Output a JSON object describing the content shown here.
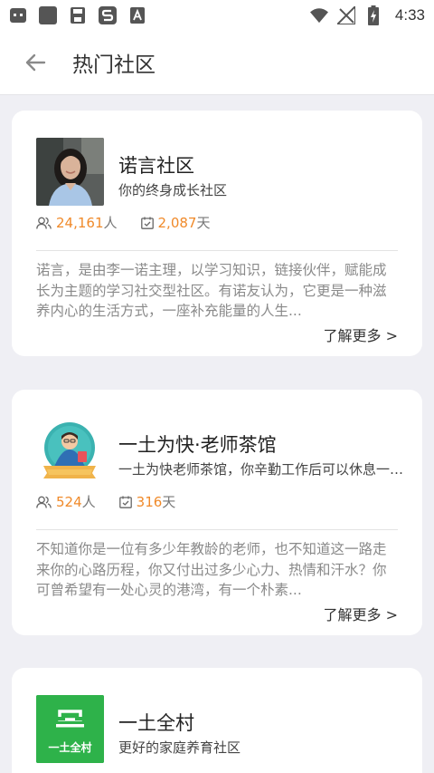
{
  "status_bar": {
    "time": "4:33",
    "left_icons": [
      "app-notification-icon",
      "gallery-icon",
      "save-icon",
      "s-app-icon",
      "a-app-icon"
    ],
    "right_icons": [
      "wifi-icon",
      "no-signal-icon",
      "battery-charging-icon"
    ]
  },
  "header": {
    "title": "热门社区",
    "back_icon": "arrow-left-icon"
  },
  "communities": [
    {
      "name": "诺言社区",
      "subtitle": "你的终身成长社区",
      "members_count": "24,161",
      "members_unit": "人",
      "days_count": "2,087",
      "days_unit": "天",
      "description": "诺言，是由李一诺主理，以学习知识，链接伙伴，赋能成长为主题的学习社交型社区。有诺友认为，它更是一种滋养内心的生活方式，一座补充能量的人生...",
      "more_label": "了解更多 >"
    },
    {
      "name": "一土为快·老师茶馆",
      "subtitle": "一土为快老师茶馆，你辛勤工作后可以休息一下的地方",
      "members_count": "524",
      "members_unit": "人",
      "days_count": "316",
      "days_unit": "天",
      "description": "不知道你是一位有多少年教龄的老师，也不知道这一路走来你的心路历程，你又付出过多少心力、热情和汗水？你可曾希望有一处心灵的港湾，有一个朴素...",
      "more_label": "了解更多 >"
    },
    {
      "name": "一土全村",
      "subtitle": "更好的家庭养育社区",
      "logo_text": "一土全村"
    }
  ],
  "colors": {
    "accent": "#f08a2a",
    "logo_green": "#2eb24a",
    "background": "#efeff4"
  }
}
